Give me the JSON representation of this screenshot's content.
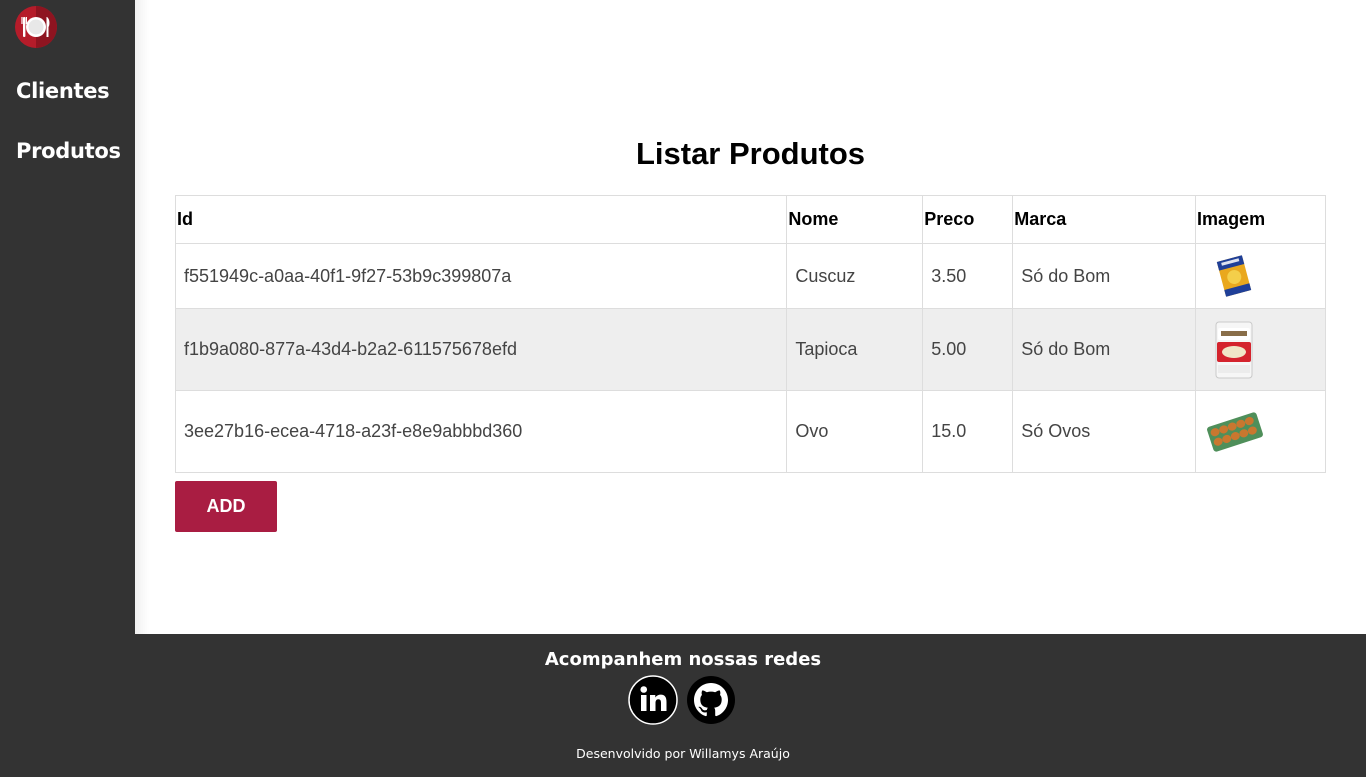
{
  "sidebar": {
    "logo_icon": "restaurant-plate-icon",
    "nav": [
      {
        "label": "Clientes"
      },
      {
        "label": "Produtos"
      }
    ]
  },
  "main": {
    "title": "Listar Produtos",
    "table": {
      "headers": [
        "Id",
        "Nome",
        "Preco",
        "Marca",
        "Imagem"
      ],
      "rows": [
        {
          "id": "f551949c-a0aa-40f1-9f27-53b9c399807a",
          "nome": "Cuscuz",
          "preco": "3.50",
          "marca": "Só do Bom",
          "imagem": "cuscuz-package-image"
        },
        {
          "id": "f1b9a080-877a-43d4-b2a2-611575678efd",
          "nome": "Tapioca",
          "preco": "5.00",
          "marca": "Só do Bom",
          "imagem": "tapioca-package-image"
        },
        {
          "id": "3ee27b16-ecea-4718-a23f-e8e9abbbd360",
          "nome": "Ovo",
          "preco": "15.0",
          "marca": "Só Ovos",
          "imagem": "egg-tray-image"
        }
      ]
    },
    "add_label": "ADD"
  },
  "footer": {
    "title": "Acompanhem nossas redes",
    "social_icons": [
      "linkedin-icon",
      "github-icon"
    ],
    "credit": "Desenvolvido por Willamys Araújo"
  },
  "colors": {
    "sidebar_bg": "#333333",
    "accent": "#a91d42",
    "logo_red": "#b51c2a",
    "row_alt": "#eeeeee"
  }
}
